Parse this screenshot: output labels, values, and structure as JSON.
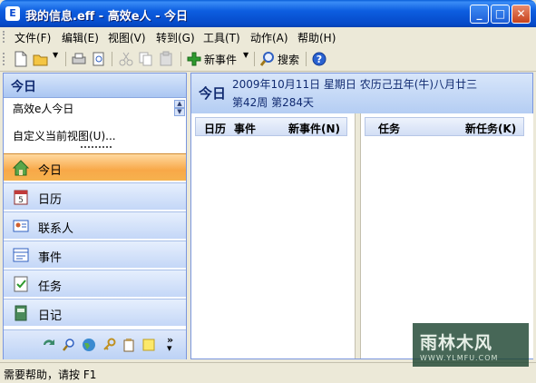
{
  "window": {
    "title": "我的信息.eff - 高效e人 - 今日",
    "app_icon_letter": "E"
  },
  "menu": [
    "文件(F)",
    "编辑(E)",
    "视图(V)",
    "转到(G)",
    "工具(T)",
    "动作(A)",
    "帮助(H)"
  ],
  "toolbar": {
    "new_event_label": "新事件",
    "search_label": "搜索"
  },
  "sidebar": {
    "header": "今日",
    "selector_value": "高效e人今日",
    "customize_link": "自定义当前视图(U)...",
    "nav_items": [
      {
        "label": "今日",
        "icon": "home-icon"
      },
      {
        "label": "日历",
        "icon": "calendar-icon"
      },
      {
        "label": "联系人",
        "icon": "contacts-icon"
      },
      {
        "label": "事件",
        "icon": "event-icon"
      },
      {
        "label": "任务",
        "icon": "task-icon"
      },
      {
        "label": "日记",
        "icon": "diary-icon"
      }
    ]
  },
  "main": {
    "title": "今日",
    "date_line": "2009年10月11日  星期日  农历己丑年(牛)八月廿三",
    "week_line": "第42周  第284天",
    "left_pane": {
      "header_calendar": "日历",
      "header_event": "事件",
      "new_event_link": "新事件(N)"
    },
    "right_pane": {
      "header_task": "任务",
      "new_task_link": "新任务(K)"
    }
  },
  "status": {
    "text": "需要帮助，请按 F1"
  },
  "watermark": {
    "text": "雨林木风",
    "url": "WWW.YLMFU.COM"
  },
  "colors": {
    "title_blue": "#0a5fd8",
    "active_nav": "#f8a848",
    "panel_blue": "#c4d7f7"
  }
}
